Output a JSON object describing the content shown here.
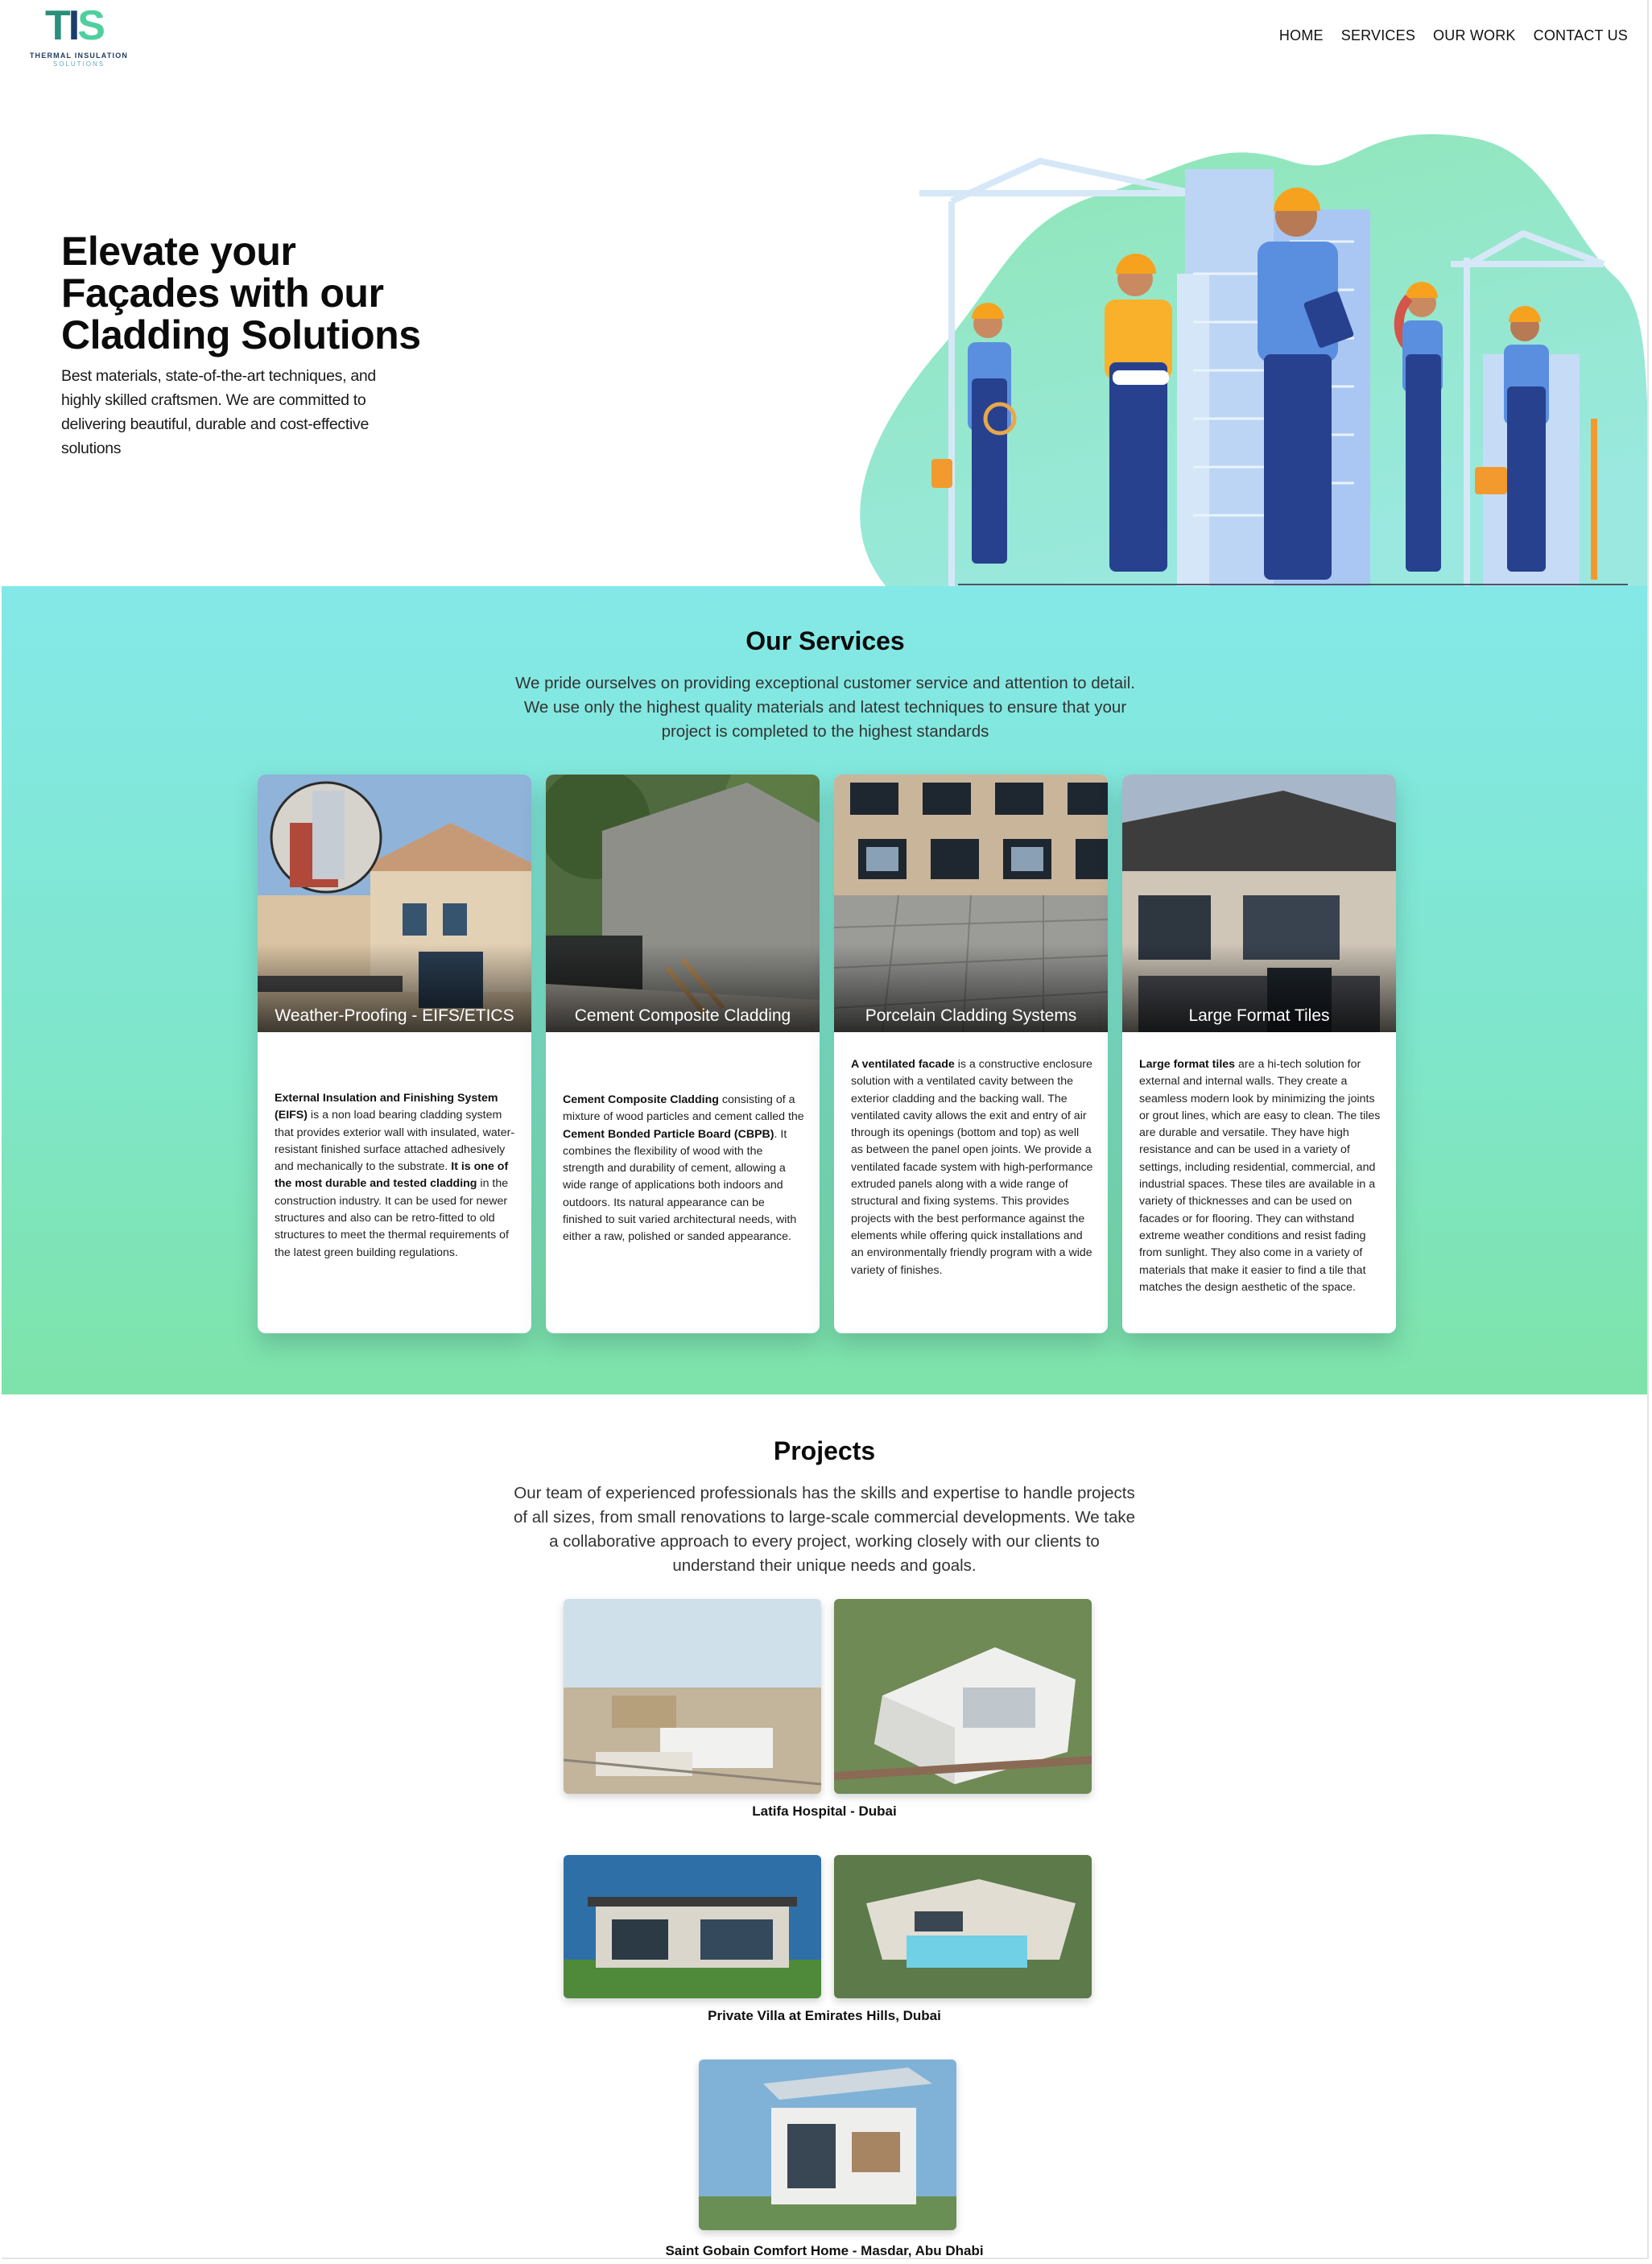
{
  "header": {
    "logo": {
      "mark": "TIS",
      "line1": "THERMAL INSULATION",
      "line2": "SOLUTIONS"
    },
    "nav": [
      "HOME",
      "SERVICES",
      "OUR WORK",
      "CONTACT US"
    ]
  },
  "hero": {
    "title": "Elevate your Façades with our Cladding Solutions",
    "subtitle": "Best materials, state-of-the-art techniques, and highly skilled craftsmen. We are committed to delivering beautiful, durable and cost-effective solutions"
  },
  "services": {
    "title": "Our Services",
    "subtitle": "We pride ourselves on providing exceptional customer service and attention to detail. We use only the highest quality materials and latest techniques to ensure that your project is completed to the highest standards",
    "cards": [
      {
        "title": "Weather-Proofing - EIFS/ETICS",
        "segments": [
          {
            "bold": true,
            "text": "External Insulation and Finishing System (EIFS)"
          },
          {
            "bold": false,
            "text": " is a non load bearing cladding system that provides exterior wall with insulated, water-resistant finished surface attached adhesively and mechanically to the substrate. "
          },
          {
            "bold": true,
            "text": "It is one of the most durable and tested cladding"
          },
          {
            "bold": false,
            "text": " in the construction industry. It can be used for newer structures and also can be retro-fitted to old structures to meet the thermal requirements of the latest green building regulations."
          }
        ]
      },
      {
        "title": "Cement Composite Cladding",
        "segments": [
          {
            "bold": true,
            "text": "Cement Composite Cladding"
          },
          {
            "bold": false,
            "text": " consisting of a mixture of wood particles and cement called the "
          },
          {
            "bold": true,
            "text": "Cement Bonded Particle Board (CBPB)"
          },
          {
            "bold": false,
            "text": ". It combines the flexibility of wood with the strength and durability of cement, allowing a wide range of applications both indoors and outdoors. Its natural appearance can be finished to suit varied architectural needs, with either a raw, polished or sanded appearance."
          }
        ]
      },
      {
        "title": "Porcelain Cladding Systems",
        "segments": [
          {
            "bold": true,
            "text": "A ventilated facade"
          },
          {
            "bold": false,
            "text": " is a constructive enclosure solution with a ventilated cavity between the exterior cladding and the backing wall. The ventilated cavity allows the exit and entry of air through its openings (bottom and top) as well as between the panel open joints. We provide a ventilated facade system with high-performance extruded panels along with a wide range of structural and fixing systems. This provides projects with the best performance against the elements while offering quick installations and an environmentally friendly program with a wide variety of finishes."
          }
        ]
      },
      {
        "title": "Large Format Tiles",
        "segments": [
          {
            "bold": true,
            "text": "Large format tiles"
          },
          {
            "bold": false,
            "text": " are a hi-tech solution for external and internal walls. They create a seamless modern look by minimizing the joints or grout lines, which are easy to clean. The tiles are durable and versatile. They have high resistance and can be used in a variety of settings, including residential, commercial, and industrial spaces. These tiles are available in a variety of thicknesses and can be used on facades or for flooring. They can withstand extreme weather conditions and resist fading from sunlight. They also come in a variety of materials that make it easier to find a tile that matches the design aesthetic of the space."
          }
        ]
      }
    ]
  },
  "projects": {
    "title": "Projects",
    "subtitle": "Our team of experienced professionals has the skills and expertise to handle projects of all sizes, from small renovations to large-scale commercial developments. We take a collaborative approach to every project, working closely with our clients to understand their unique needs and goals.",
    "items": [
      {
        "caption": "Latifa Hospital - Dubai"
      },
      {
        "caption": "Private Villa at Emirates Hills, Dubai"
      },
      {
        "caption": "Saint Gobain Comfort Home - Masdar, Abu Dhabi"
      }
    ]
  },
  "colors": {
    "brand_teal": "#2a8f7a",
    "brand_navy": "#1b3d6e",
    "brand_green": "#4fcf9f",
    "services_bg_top": "#84e8e8",
    "services_bg_bottom": "#7ee3a9"
  }
}
